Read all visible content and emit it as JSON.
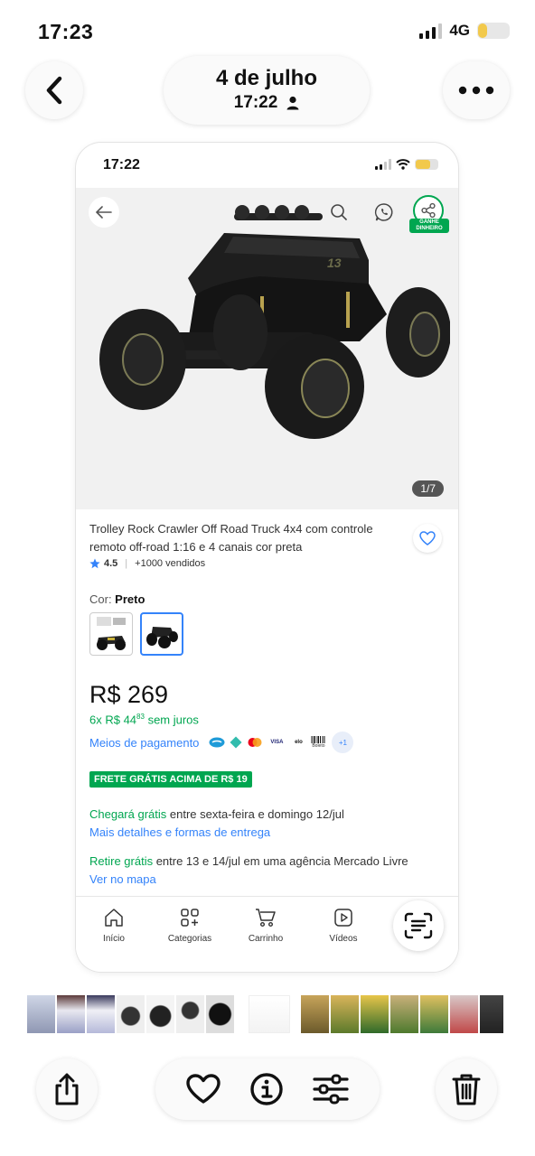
{
  "status_bar": {
    "time": "17:23",
    "network": "4G"
  },
  "header": {
    "date": "4 de julho",
    "time": "17:22"
  },
  "screenshot": {
    "status_time": "17:22",
    "image_counter": "1/7",
    "share_badge": "GANHE DINHEIRO",
    "product_title": "Trolley Rock Crawler Off Road Truck 4x4 com controle remoto off-road 1:16 e 4 canais cor preta",
    "rating": "4.5",
    "sold": "+1000 vendidos",
    "color_label": "Cor: ",
    "color_value": "Preto",
    "price": "R$ 269",
    "installments_prefix": "6x R$ 44",
    "installments_cents": "83",
    "installments_suffix": " sem juros",
    "payment_link": "Meios de pagamento",
    "payment_more": "+1",
    "payment_boleto": "Boleto",
    "free_shipping_badge": "FRETE GRÁTIS ACIMA DE R$ 19",
    "delivery_highlight": "Chegará grátis",
    "delivery_text": " entre sexta-feira e domingo 12/jul",
    "delivery_link": "Mais detalhes e formas de entrega",
    "pickup_highlight": "Retire grátis",
    "pickup_text": " entre 13 e 14/jul em uma agência Mercado Livre",
    "pickup_link": "Ver no mapa",
    "nav": {
      "home": "Início",
      "categories": "Categorias",
      "cart": "Carrinho",
      "videos": "Vídeos"
    }
  },
  "colors": {
    "accent_blue": "#3483fa",
    "success_green": "#00a650"
  }
}
